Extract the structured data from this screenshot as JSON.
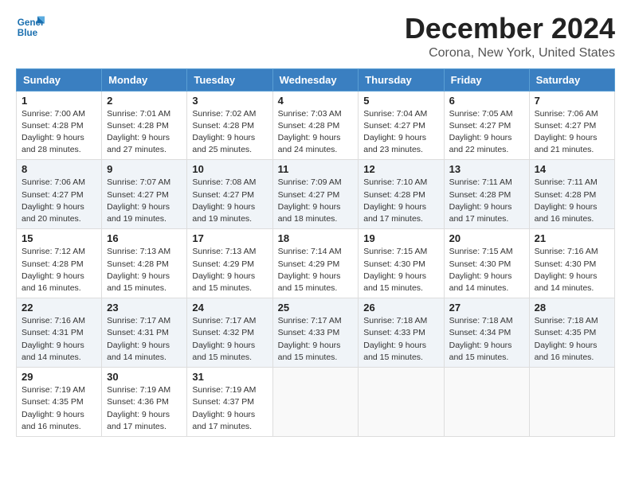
{
  "logo": {
    "line1": "General",
    "line2": "Blue"
  },
  "title": "December 2024",
  "subtitle": "Corona, New York, United States",
  "days_of_week": [
    "Sunday",
    "Monday",
    "Tuesday",
    "Wednesday",
    "Thursday",
    "Friday",
    "Saturday"
  ],
  "weeks": [
    [
      {
        "day": "1",
        "sunrise": "7:00 AM",
        "sunset": "4:28 PM",
        "daylight": "9 hours and 28 minutes."
      },
      {
        "day": "2",
        "sunrise": "7:01 AM",
        "sunset": "4:28 PM",
        "daylight": "9 hours and 27 minutes."
      },
      {
        "day": "3",
        "sunrise": "7:02 AM",
        "sunset": "4:28 PM",
        "daylight": "9 hours and 25 minutes."
      },
      {
        "day": "4",
        "sunrise": "7:03 AM",
        "sunset": "4:28 PM",
        "daylight": "9 hours and 24 minutes."
      },
      {
        "day": "5",
        "sunrise": "7:04 AM",
        "sunset": "4:27 PM",
        "daylight": "9 hours and 23 minutes."
      },
      {
        "day": "6",
        "sunrise": "7:05 AM",
        "sunset": "4:27 PM",
        "daylight": "9 hours and 22 minutes."
      },
      {
        "day": "7",
        "sunrise": "7:06 AM",
        "sunset": "4:27 PM",
        "daylight": "9 hours and 21 minutes."
      }
    ],
    [
      {
        "day": "8",
        "sunrise": "7:06 AM",
        "sunset": "4:27 PM",
        "daylight": "9 hours and 20 minutes."
      },
      {
        "day": "9",
        "sunrise": "7:07 AM",
        "sunset": "4:27 PM",
        "daylight": "9 hours and 19 minutes."
      },
      {
        "day": "10",
        "sunrise": "7:08 AM",
        "sunset": "4:27 PM",
        "daylight": "9 hours and 19 minutes."
      },
      {
        "day": "11",
        "sunrise": "7:09 AM",
        "sunset": "4:27 PM",
        "daylight": "9 hours and 18 minutes."
      },
      {
        "day": "12",
        "sunrise": "7:10 AM",
        "sunset": "4:28 PM",
        "daylight": "9 hours and 17 minutes."
      },
      {
        "day": "13",
        "sunrise": "7:11 AM",
        "sunset": "4:28 PM",
        "daylight": "9 hours and 17 minutes."
      },
      {
        "day": "14",
        "sunrise": "7:11 AM",
        "sunset": "4:28 PM",
        "daylight": "9 hours and 16 minutes."
      }
    ],
    [
      {
        "day": "15",
        "sunrise": "7:12 AM",
        "sunset": "4:28 PM",
        "daylight": "9 hours and 16 minutes."
      },
      {
        "day": "16",
        "sunrise": "7:13 AM",
        "sunset": "4:28 PM",
        "daylight": "9 hours and 15 minutes."
      },
      {
        "day": "17",
        "sunrise": "7:13 AM",
        "sunset": "4:29 PM",
        "daylight": "9 hours and 15 minutes."
      },
      {
        "day": "18",
        "sunrise": "7:14 AM",
        "sunset": "4:29 PM",
        "daylight": "9 hours and 15 minutes."
      },
      {
        "day": "19",
        "sunrise": "7:15 AM",
        "sunset": "4:30 PM",
        "daylight": "9 hours and 15 minutes."
      },
      {
        "day": "20",
        "sunrise": "7:15 AM",
        "sunset": "4:30 PM",
        "daylight": "9 hours and 14 minutes."
      },
      {
        "day": "21",
        "sunrise": "7:16 AM",
        "sunset": "4:30 PM",
        "daylight": "9 hours and 14 minutes."
      }
    ],
    [
      {
        "day": "22",
        "sunrise": "7:16 AM",
        "sunset": "4:31 PM",
        "daylight": "9 hours and 14 minutes."
      },
      {
        "day": "23",
        "sunrise": "7:17 AM",
        "sunset": "4:31 PM",
        "daylight": "9 hours and 14 minutes."
      },
      {
        "day": "24",
        "sunrise": "7:17 AM",
        "sunset": "4:32 PM",
        "daylight": "9 hours and 15 minutes."
      },
      {
        "day": "25",
        "sunrise": "7:17 AM",
        "sunset": "4:33 PM",
        "daylight": "9 hours and 15 minutes."
      },
      {
        "day": "26",
        "sunrise": "7:18 AM",
        "sunset": "4:33 PM",
        "daylight": "9 hours and 15 minutes."
      },
      {
        "day": "27",
        "sunrise": "7:18 AM",
        "sunset": "4:34 PM",
        "daylight": "9 hours and 15 minutes."
      },
      {
        "day": "28",
        "sunrise": "7:18 AM",
        "sunset": "4:35 PM",
        "daylight": "9 hours and 16 minutes."
      }
    ],
    [
      {
        "day": "29",
        "sunrise": "7:19 AM",
        "sunset": "4:35 PM",
        "daylight": "9 hours and 16 minutes."
      },
      {
        "day": "30",
        "sunrise": "7:19 AM",
        "sunset": "4:36 PM",
        "daylight": "9 hours and 17 minutes."
      },
      {
        "day": "31",
        "sunrise": "7:19 AM",
        "sunset": "4:37 PM",
        "daylight": "9 hours and 17 minutes."
      },
      null,
      null,
      null,
      null
    ]
  ],
  "labels": {
    "sunrise": "Sunrise:",
    "sunset": "Sunset:",
    "daylight": "Daylight:"
  }
}
